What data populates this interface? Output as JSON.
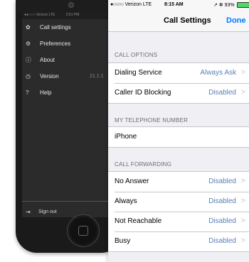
{
  "back_phone": {
    "status": {
      "carrier": "●●○○○ Verizon LTE",
      "time": "2:51 PM"
    },
    "menu": [
      {
        "icon": "gear-icon",
        "glyph": "✿",
        "label": "Call settings"
      },
      {
        "icon": "gears-icon",
        "glyph": "⚙",
        "label": "Preferences"
      },
      {
        "icon": "info-icon",
        "glyph": "ⓘ",
        "label": "About"
      },
      {
        "icon": "clock-icon",
        "glyph": "◷",
        "label": "Version",
        "value": "21.1.1"
      },
      {
        "icon": "help-icon",
        "glyph": "?",
        "label": "Help"
      }
    ],
    "signout": {
      "icon": "signout-icon",
      "glyph": "⇥",
      "label": "Sign out"
    }
  },
  "front_phone": {
    "status": {
      "signal": "●○○○○",
      "carrier": "Verizon",
      "network": "LTE",
      "time": "8:15 AM",
      "right": "↗ ✻ 93%"
    },
    "navbar": {
      "title": "Call Settings",
      "done": "Done"
    },
    "sections": {
      "call_options": {
        "header": "CALL OPTIONS",
        "rows": [
          {
            "label": "Dialing Service",
            "value": "Always Ask"
          },
          {
            "label": "Caller ID Blocking",
            "value": "Disabled"
          }
        ]
      },
      "my_number": {
        "header": "MY TELEPHONE NUMBER",
        "rows": [
          {
            "label": "iPhone"
          }
        ]
      },
      "call_forwarding": {
        "header": "CALL FORWARDING",
        "rows": [
          {
            "label": "No Answer",
            "value": "Disabled"
          },
          {
            "label": "Always",
            "value": "Disabled"
          },
          {
            "label": "Not Reachable",
            "value": "Disabled"
          },
          {
            "label": "Busy",
            "value": "Disabled"
          }
        ]
      }
    },
    "chevron": ">"
  },
  "colors": {
    "accent": "#007aff",
    "value_blue": "#5a7fb5",
    "battery": "#4cd964",
    "menu_bg": "#2b2b2b"
  }
}
